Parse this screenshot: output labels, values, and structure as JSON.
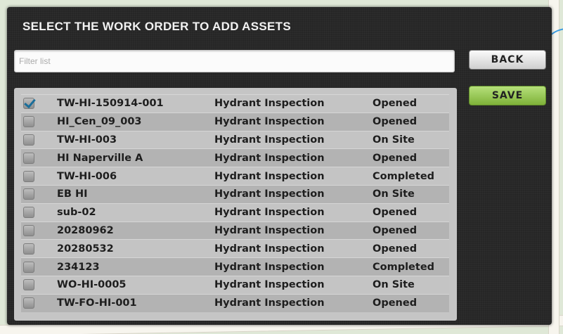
{
  "dialog": {
    "title": "SELECT THE WORK ORDER TO ADD ASSETS",
    "filter_placeholder": "Filter list",
    "back_label": "BACK",
    "save_label": "SAVE"
  },
  "work_orders": [
    {
      "name": "TW-HI-150914-001",
      "type": "Hydrant Inspection",
      "status": "Opened",
      "checked": true
    },
    {
      "name": "HI_Cen_09_003",
      "type": "Hydrant Inspection",
      "status": "Opened",
      "checked": false
    },
    {
      "name": "TW-HI-003",
      "type": "Hydrant Inspection",
      "status": "On Site",
      "checked": false
    },
    {
      "name": "HI Naperville A",
      "type": "Hydrant Inspection",
      "status": "Opened",
      "checked": false
    },
    {
      "name": "TW-HI-006",
      "type": "Hydrant Inspection",
      "status": "Completed",
      "checked": false
    },
    {
      "name": "EB HI",
      "type": "Hydrant Inspection",
      "status": "On Site",
      "checked": false
    },
    {
      "name": "sub-02",
      "type": "Hydrant Inspection",
      "status": "Opened",
      "checked": false
    },
    {
      "name": "20280962",
      "type": "Hydrant Inspection",
      "status": "Opened",
      "checked": false
    },
    {
      "name": "20280532",
      "type": "Hydrant Inspection",
      "status": "Opened",
      "checked": false
    },
    {
      "name": "234123",
      "type": "Hydrant Inspection",
      "status": "Completed",
      "checked": false
    },
    {
      "name": "WO-HI-0005",
      "type": "Hydrant Inspection",
      "status": "On Site",
      "checked": false
    },
    {
      "name": "TW-FO-HI-001",
      "type": "Hydrant Inspection",
      "status": "Opened",
      "checked": false
    }
  ]
}
